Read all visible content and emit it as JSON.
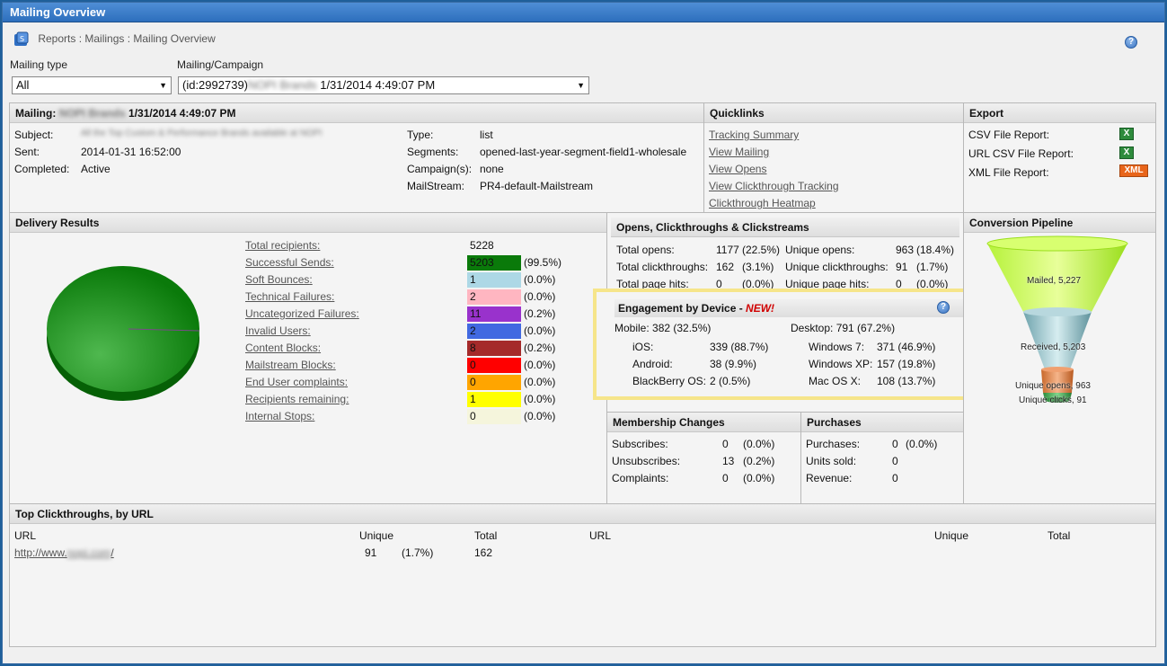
{
  "window": {
    "title": "Mailing Overview"
  },
  "breadcrumb": "Reports : Mailings : Mailing Overview",
  "filters": {
    "mailing_type_label": "Mailing type",
    "mailing_type_value": "All",
    "campaign_label": "Mailing/Campaign",
    "campaign_id": "(id:2992739)",
    "campaign_name": "NOPI Brands",
    "campaign_date": "1/31/2014 4:49:07 PM"
  },
  "mailing": {
    "header_label": "Mailing:",
    "header_name": "NOPI Brands",
    "header_date": "1/31/2014 4:49:07 PM",
    "subject_label": "Subject:",
    "subject_value": "All the Top Custom & Performance Brands available at NOPI",
    "sent_label": "Sent:",
    "sent_value": "2014-01-31 16:52:00",
    "completed_label": "Completed:",
    "completed_value": "Active",
    "type_label": "Type:",
    "type_value": "list",
    "segments_label": "Segments:",
    "segments_value": "opened-last-year-segment-field1-wholesale",
    "campaigns_label": "Campaign(s):",
    "campaigns_value": "none",
    "mailstream_label": "MailStream:",
    "mailstream_value": "PR4-default-Mailstream"
  },
  "quicklinks": {
    "title": "Quicklinks",
    "items": [
      "Tracking Summary",
      "View Mailing",
      "View Opens",
      "View Clickthrough Tracking",
      "Clickthrough Heatmap"
    ]
  },
  "export": {
    "title": "Export",
    "items": [
      "CSV File Report:",
      "URL CSV File Report:",
      "XML File Report:"
    ],
    "xls_icon_text": "X",
    "xml_icon_text": "XML"
  },
  "delivery": {
    "title": "Delivery Results",
    "rows": [
      {
        "label": "Total recipients",
        "value": "5228",
        "pct": "",
        "color": ""
      },
      {
        "label": "Successful Sends",
        "value": "5203",
        "pct": "(99.5%)",
        "color": "#0a7a0a"
      },
      {
        "label": "Soft Bounces",
        "value": "1",
        "pct": "(0.0%)",
        "color": "#add8e6"
      },
      {
        "label": "Technical Failures",
        "value": "2",
        "pct": "(0.0%)",
        "color": "#ffb6c1"
      },
      {
        "label": "Uncategorized Failures",
        "value": "11",
        "pct": "(0.2%)",
        "color": "#9932cc"
      },
      {
        "label": "Invalid Users",
        "value": "2",
        "pct": "(0.0%)",
        "color": "#4169e1"
      },
      {
        "label": "Content Blocks",
        "value": "8",
        "pct": "(0.2%)",
        "color": "#a52a2a"
      },
      {
        "label": "Mailstream Blocks",
        "value": "0",
        "pct": "(0.0%)",
        "color": "#ff0000"
      },
      {
        "label": "End User complaints",
        "value": "0",
        "pct": "(0.0%)",
        "color": "#ffa500"
      },
      {
        "label": "Recipients remaining",
        "value": "1",
        "pct": "(0.0%)",
        "color": "#ffff00"
      },
      {
        "label": "Internal Stops",
        "value": "0",
        "pct": "(0.0%)",
        "color": "#f5f5dc"
      }
    ],
    "pie_color": "#0a7a0a"
  },
  "opens": {
    "title": "Opens, Clickthroughs & Clickstreams",
    "total_opens_label": "Total opens:",
    "total_opens": "1177",
    "total_opens_pct": "(22.5%)",
    "unique_opens_label": "Unique opens:",
    "unique_opens": "963",
    "unique_opens_pct": "(18.4%)",
    "total_ct_label": "Total clickthroughs:",
    "total_ct": "162",
    "total_ct_pct": "(3.1%)",
    "unique_ct_label": "Unique clickthroughs:",
    "unique_ct": "91",
    "unique_ct_pct": "(1.7%)",
    "total_hits_label": "Total page hits:",
    "total_hits": "0",
    "total_hits_pct": "(0.0%)",
    "unique_hits_label": "Unique page hits:",
    "unique_hits": "0",
    "unique_hits_pct": "(0.0%)"
  },
  "engagement": {
    "title": "Engagement by Device - ",
    "new_tag": "NEW!",
    "mobile": "Mobile:  382 (32.5%)",
    "desktop": "Desktop:  791 (67.2%)",
    "ios_label": "iOS:",
    "ios": "339 (88.7%)",
    "android_label": "Android:",
    "android": "38  (9.9%)",
    "bb_label": "BlackBerry OS:",
    "bb": "2    (0.5%)",
    "win7_label": "Windows 7:",
    "win7": "371 (46.9%)",
    "winxp_label": "Windows XP:",
    "winxp": "157 (19.8%)",
    "mac_label": "Mac OS X:",
    "mac": "108 (13.7%)"
  },
  "membership": {
    "title": "Membership Changes",
    "subscribes_label": "Subscribes:",
    "subscribes": "0",
    "subscribes_pct": "(0.0%)",
    "unsubscribes_label": "Unsubscribes:",
    "unsubscribes": "13",
    "unsubscribes_pct": "(0.2%)",
    "complaints_label": "Complaints:",
    "complaints": "0",
    "complaints_pct": "(0.0%)"
  },
  "purchases": {
    "title": "Purchases",
    "purchases_label": "Purchases:",
    "purchases": "0",
    "purchases_pct": "(0.0%)",
    "units_label": "Units sold:",
    "units": "0",
    "revenue_label": "Revenue:",
    "revenue": "0"
  },
  "pipeline": {
    "title": "Conversion Pipeline",
    "stages": [
      "Mailed, 5,227",
      "Received, 5,203",
      "Unique opens, 963",
      "Unique clicks, 91"
    ]
  },
  "clickthroughs": {
    "title": "Top Clickthroughs, by URL",
    "col_url": "URL",
    "col_unique": "Unique",
    "col_total": "Total",
    "col_url2": "URL",
    "col_unique2": "Unique",
    "col_total2": "Total",
    "row_url_prefix": "http://www.",
    "row_url_blur": "nopi.com",
    "row_url_suffix": "/",
    "row_unique": "91",
    "row_unique_pct": "(1.7%)",
    "row_total": "162"
  }
}
